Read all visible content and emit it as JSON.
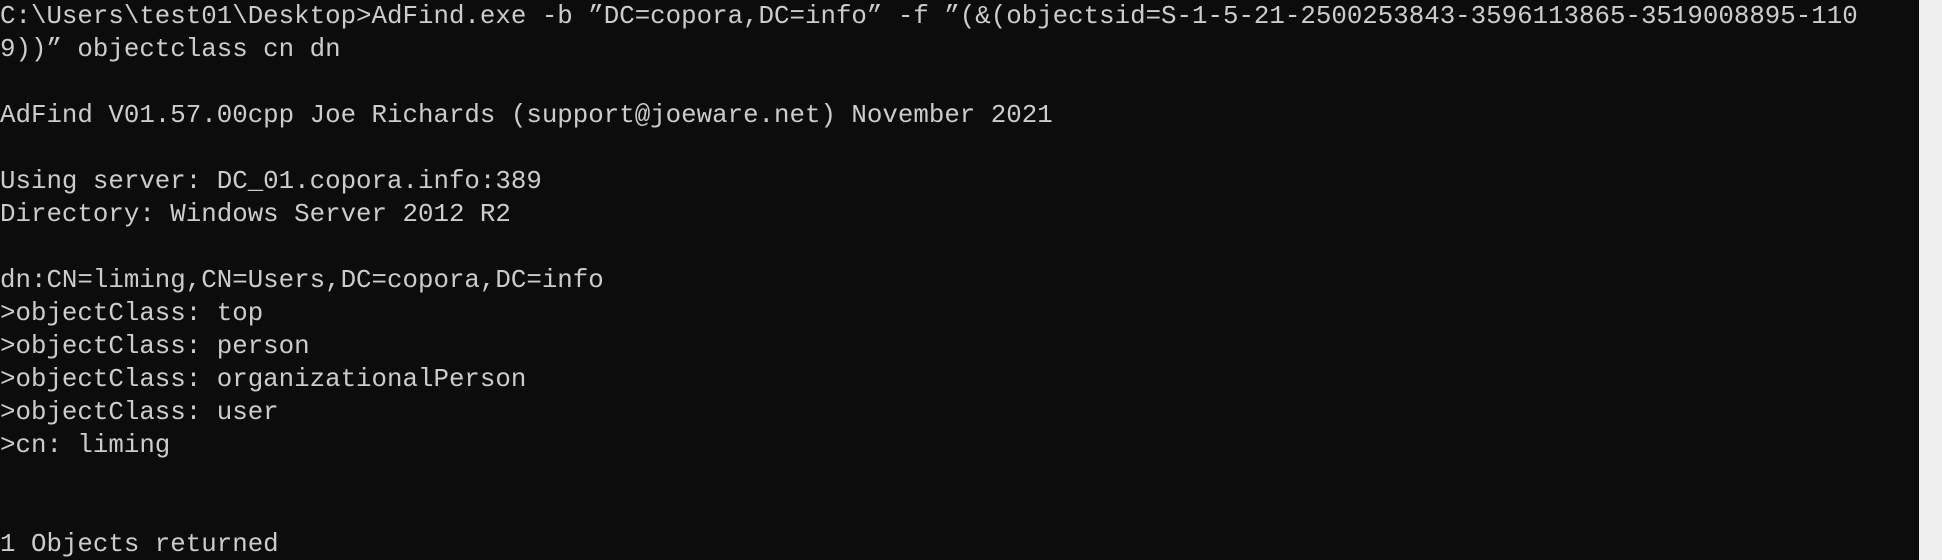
{
  "console": {
    "lines": [
      "C:\\Users\\test01\\Desktop>AdFind.exe -b ”DC=copora,DC=info” -f ”(&(objectsid=S-1-5-21-2500253843-3596113865-3519008895-110",
      "9))” objectclass cn dn",
      "",
      "AdFind V01.57.00cpp Joe Richards (support@joeware.net) November 2021",
      "",
      "Using server: DC_01.copora.info:389",
      "Directory: Windows Server 2012 R2",
      "",
      "dn:CN=liming,CN=Users,DC=copora,DC=info",
      ">objectClass: top",
      ">objectClass: person",
      ">objectClass: organizationalPerson",
      ">objectClass: user",
      ">cn: liming",
      "",
      "",
      "1 Objects returned"
    ]
  },
  "colors": {
    "background": "#0c0c0c",
    "text": "#cccccc",
    "scrollbar": "#f0f0f0"
  }
}
